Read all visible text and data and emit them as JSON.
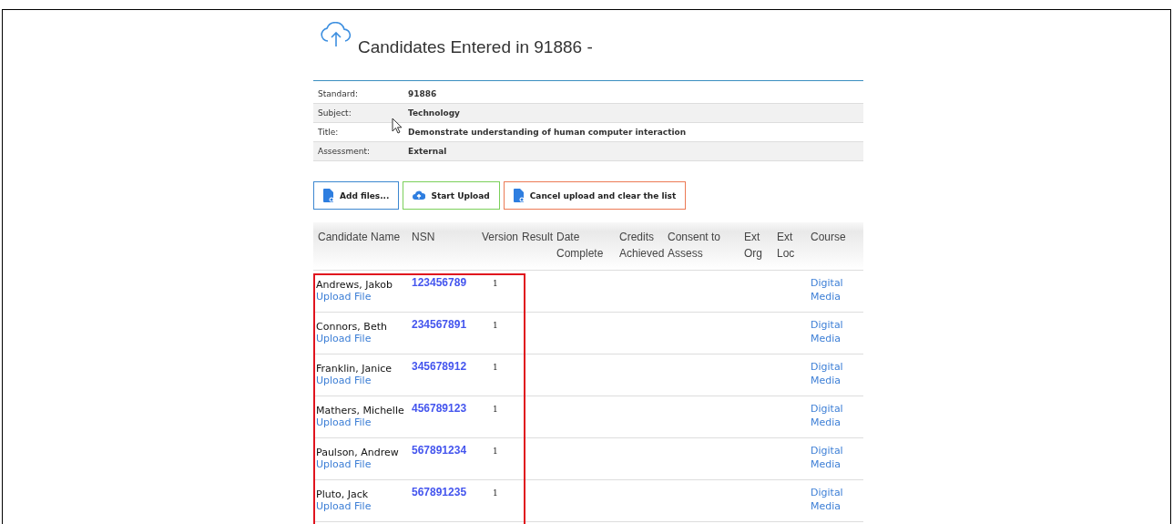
{
  "title": "Candidates Entered in 91886 -",
  "details": [
    {
      "label": "Standard:",
      "value": "91886"
    },
    {
      "label": "Subject:",
      "value": "Technology"
    },
    {
      "label": "Title:",
      "value": "Demonstrate understanding of human computer interaction"
    },
    {
      "label": "Assessment:",
      "value": "External"
    }
  ],
  "buttons": [
    {
      "kind": "add",
      "label": "Add files..."
    },
    {
      "kind": "upload",
      "label": "Start Upload"
    },
    {
      "kind": "cancel",
      "label": "Cancel upload and clear the list"
    }
  ],
  "columns": [
    "Candidate Name",
    "NSN",
    "Version",
    "Result",
    "Date Complete",
    "Credits Achieved",
    "Consent to Assess",
    "Ext Org",
    "Ext Loc",
    "Course"
  ],
  "rows": [
    {
      "name": "Andrews, Jakob",
      "link": "Upload File",
      "nsn": "123456789",
      "version": "1",
      "course": "Digital Media"
    },
    {
      "name": "Connors, Beth",
      "link": "Upload File",
      "nsn": "234567891",
      "version": "1",
      "course": "Digital Media"
    },
    {
      "name": "Franklin, Janice",
      "link": "Upload File",
      "nsn": "345678912",
      "version": "1",
      "course": "Digital Media"
    },
    {
      "name": "Mathers, Michelle",
      "link": "Upload File",
      "nsn": "456789123",
      "version": "1",
      "course": "Digital Media"
    },
    {
      "name": "Paulson, Andrew",
      "link": "Upload File",
      "nsn": "567891234",
      "version": "1",
      "course": "Digital Media"
    },
    {
      "name": "Pluto, Jack",
      "link": "Upload File",
      "nsn": "567891235",
      "version": "1",
      "course": "Digital Media"
    }
  ]
}
